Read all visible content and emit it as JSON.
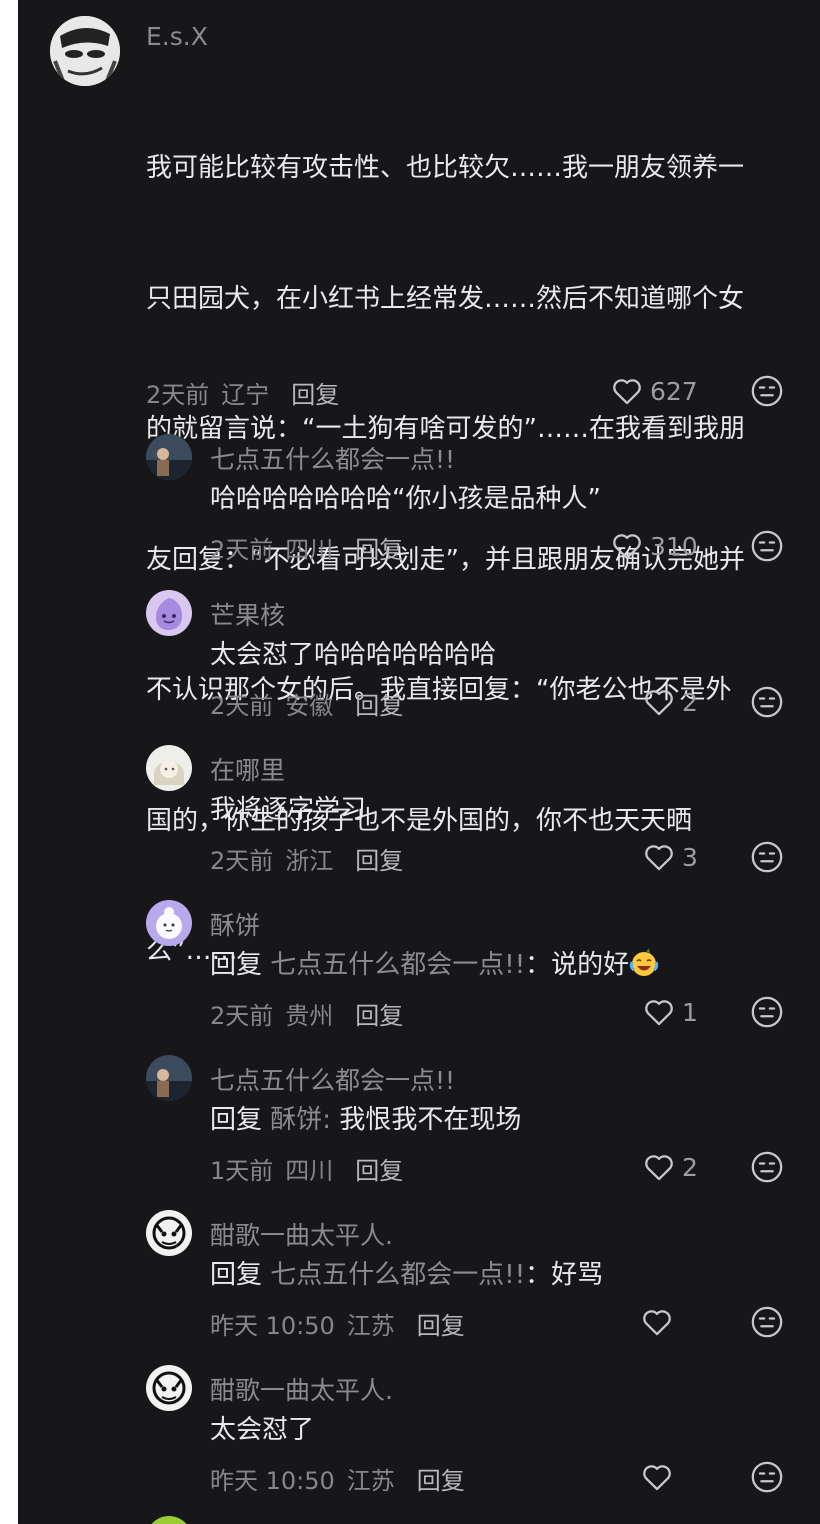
{
  "comments": [
    {
      "user": "E.s.X",
      "lines": [
        "我可能比较有攻击性、也比较欠……我一朋友领养一",
        "只田园犬，在小红书上经常发……然后不知道哪个女",
        "的就留言说：“一土狗有啥可发的”……在我看到我朋",
        "友回复：“不必看可以划走”，并且跟朋友确认完她并",
        "不认识那个女的后。我直接回复：“你老公也不是外",
        "国的，你生的孩子也不是外国的，你不也天天晒",
        "么”……"
      ],
      "time": "2天前",
      "location": "辽宁",
      "reply": "回复",
      "likes": "627"
    },
    {
      "user": "七点五什么都会一点!!",
      "text": "哈哈哈哈哈哈哈“你小孩是品种人”",
      "time": "2天前",
      "location": "四川",
      "reply": "回复",
      "likes": "310"
    },
    {
      "user": "芒果核",
      "text": "太会怼了哈哈哈哈哈哈哈",
      "time": "2天前",
      "location": "安徽",
      "reply": "回复",
      "likes": "2"
    },
    {
      "user": "在哪里",
      "text": "我将逐字学习",
      "time": "2天前",
      "location": "浙江",
      "reply": "回复",
      "likes": "3"
    },
    {
      "user": "酥饼",
      "reply_prefix": "回复",
      "reply_target": "七点五什么都会一点!!",
      "text": "：说的好",
      "time": "2天前",
      "location": "贵州",
      "reply": "回复",
      "likes": "1"
    },
    {
      "user": "七点五什么都会一点!!",
      "reply_prefix": "回复",
      "reply_target": "酥饼:",
      "text": "我恨我不在现场",
      "time": "1天前",
      "location": "四川",
      "reply": "回复",
      "likes": "2"
    },
    {
      "user": "酣歌一曲太平人.",
      "reply_prefix": "回复",
      "reply_target": "七点五什么都会一点!!",
      "text": "：好骂",
      "time": "昨天 10:50",
      "location": "江苏",
      "reply": "回复",
      "likes": ""
    },
    {
      "user": "酣歌一曲太平人.",
      "text": "太会怼了",
      "time": "昨天 10:50",
      "location": "江苏",
      "reply": "回复",
      "likes": ""
    }
  ],
  "icons": {
    "like": "heart-outline-icon",
    "dislike": "neutral-face-icon",
    "emoji": "crying-laughing-emoji"
  },
  "colors": {
    "background": "#17171a",
    "text": "#e9e9ec",
    "muted": "#8a8a8f"
  }
}
